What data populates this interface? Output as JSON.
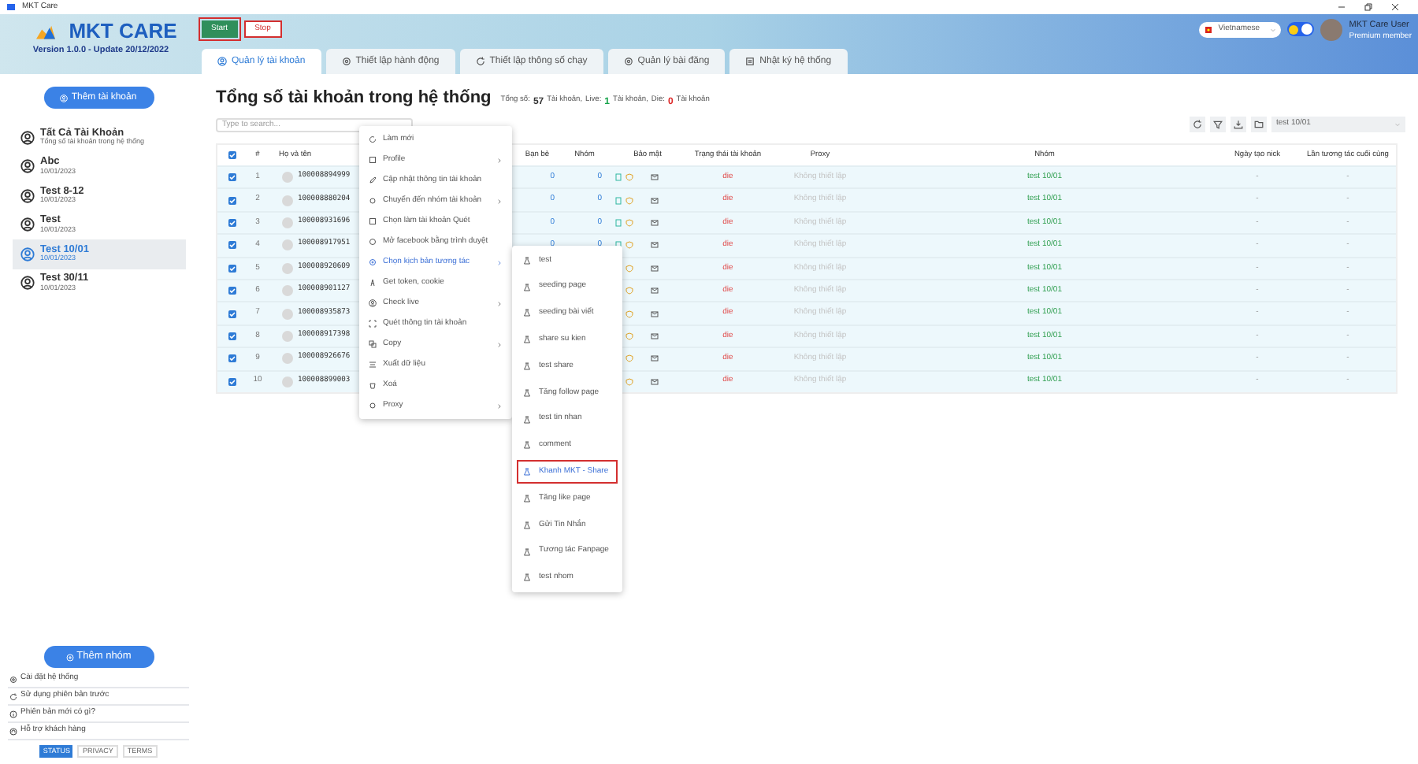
{
  "app_title": "MKT Care",
  "logo": {
    "name": "MKT CARE",
    "version": "Version 1.0.0 - Update 20/12/2022"
  },
  "run_buttons": [
    {
      "kind": "start",
      "label": "Start"
    },
    {
      "kind": "stop",
      "label": "Stop"
    }
  ],
  "tabs": [
    {
      "label": "Quản lý tài khoản",
      "selected": true
    },
    {
      "label": "Thiết lập hành động",
      "selected": false
    },
    {
      "label": "Thiết lập thông số chạy",
      "selected": false
    },
    {
      "label": "Quản lý bài đăng",
      "selected": false
    },
    {
      "label": "Nhật ký hệ thống",
      "selected": false
    }
  ],
  "language": "Vietnamese",
  "theme_toggle": {
    "on": true
  },
  "user": {
    "name": "MKT Care User",
    "badge": "Premium member"
  },
  "sidebar": {
    "add_button": "Thêm tài khoản",
    "items": [
      {
        "title": "Tất Cả Tài Khoản",
        "subtitle": "Tổng số tài khoản trong hệ thống",
        "selected": false
      },
      {
        "title": "Abc",
        "subtitle": "10/01/2023",
        "selected": false
      },
      {
        "title": "Test 8-12",
        "subtitle": "10/01/2023",
        "selected": false
      },
      {
        "title": "Test",
        "subtitle": "10/01/2023",
        "selected": false
      },
      {
        "title": "Test 10/01",
        "subtitle": "10/01/2023",
        "selected": true
      },
      {
        "title": "Test 30/11",
        "subtitle": "10/01/2023",
        "selected": false
      }
    ],
    "add_group_button": "Thêm nhóm",
    "links": [
      "Cài đặt hệ thống",
      "Sử dụng phiên bản trước",
      "Phiên bản mới có gì?",
      "Hỗ trợ khách hàng"
    ],
    "footer_tabs": [
      {
        "label": "STATUS",
        "selected": true
      },
      {
        "label": "PRIVACY",
        "selected": false
      },
      {
        "label": "TERMS",
        "selected": false
      }
    ]
  },
  "main": {
    "title": "Tổng số tài khoản trong hệ thống",
    "stats": [
      {
        "label": "Tổng số:",
        "value": "57",
        "unit": "Tài khoản,",
        "color": "#333333"
      },
      {
        "label": "Live:",
        "value": "1",
        "unit": "Tài khoản,",
        "color": "#16a34a"
      },
      {
        "label": "Die:",
        "value": "0",
        "unit": "Tài khoản",
        "color": "#dc2626"
      }
    ],
    "search": {
      "placeholder": "Type to search..."
    },
    "group_select": "test 10/01"
  },
  "table": {
    "select_all_checked": true,
    "columns": [
      "#",
      "Họ và tên",
      "Bạn bè",
      "Nhóm",
      "Bảo mật",
      "Trạng thái tài khoản",
      "Proxy",
      "Nhóm",
      "Ngày tạo nick",
      "Lần tương tác cuối cùng"
    ],
    "rows": [
      {
        "checked": true,
        "index": "1",
        "name": "100008894999",
        "friends": "0",
        "groups": "0",
        "status": "die",
        "proxy": "Không thiết lập",
        "group": "test 10/01",
        "created": "-",
        "last": "-"
      },
      {
        "checked": true,
        "index": "2",
        "name": "100008880204",
        "friends": "0",
        "groups": "0",
        "status": "die",
        "proxy": "Không thiết lập",
        "group": "test 10/01",
        "created": "-",
        "last": "-"
      },
      {
        "checked": true,
        "index": "3",
        "name": "100008931696",
        "friends": "0",
        "groups": "0",
        "status": "die",
        "proxy": "Không thiết lập",
        "group": "test 10/01",
        "created": "-",
        "last": "-"
      },
      {
        "checked": true,
        "index": "4",
        "name": "100008917951",
        "friends": "0",
        "groups": "0",
        "status": "die",
        "proxy": "Không thiết lập",
        "group": "test 10/01",
        "created": "-",
        "last": "-"
      },
      {
        "checked": true,
        "index": "5",
        "name": "100008920609",
        "status": "die",
        "proxy": "Không thiết lập",
        "group": "test 10/01",
        "created": "-",
        "last": "-"
      },
      {
        "checked": true,
        "index": "6",
        "name": "100008901127",
        "status": "die",
        "proxy": "Không thiết lập",
        "group": "test 10/01",
        "created": "-",
        "last": "-"
      },
      {
        "checked": true,
        "index": "7",
        "name": "100008935873",
        "status": "die",
        "proxy": "Không thiết lập",
        "group": "test 10/01",
        "created": "-",
        "last": "-"
      },
      {
        "checked": true,
        "index": "8",
        "name": "100008917398",
        "status": "die",
        "proxy": "Không thiết lập",
        "group": "test 10/01",
        "created": "-",
        "last": "-"
      },
      {
        "checked": true,
        "index": "9",
        "name": "100008926676",
        "status": "die",
        "proxy": "Không thiết lập",
        "group": "test 10/01",
        "created": "-",
        "last": "-"
      },
      {
        "checked": true,
        "index": "10",
        "name": "100008899003",
        "status": "die",
        "proxy": "Không thiết lập",
        "group": "test 10/01",
        "created": "-",
        "last": "-"
      }
    ]
  },
  "context_menu": [
    {
      "label": "Làm mới",
      "submenu": false,
      "selected": false
    },
    {
      "label": "Profile",
      "submenu": true,
      "selected": false
    },
    {
      "label": "Cập nhật thông tin tài khoản",
      "submenu": false,
      "selected": false
    },
    {
      "label": "Chuyển đến nhóm tài khoản",
      "submenu": true,
      "selected": false
    },
    {
      "label": "Chọn làm tài khoản Quét",
      "submenu": false,
      "selected": false
    },
    {
      "label": "Mở facebook bằng trình duyệt",
      "submenu": false,
      "selected": false
    },
    {
      "label": "Chọn kịch bản tương tác",
      "submenu": true,
      "selected": true
    },
    {
      "label": "Get token, cookie",
      "submenu": false,
      "selected": false
    },
    {
      "label": "Check live",
      "submenu": true,
      "selected": false
    },
    {
      "label": "Quét thông tin tài khoản",
      "submenu": false,
      "selected": false
    },
    {
      "label": "Copy",
      "submenu": true,
      "selected": false
    },
    {
      "label": "Xuất dữ liệu",
      "submenu": false,
      "selected": false
    },
    {
      "label": "Xoá",
      "submenu": false,
      "selected": false
    },
    {
      "label": "Proxy",
      "submenu": true,
      "selected": false
    }
  ],
  "submenu": [
    {
      "label": "test",
      "selected": false
    },
    {
      "label": "seeding page",
      "selected": false
    },
    {
      "label": "seeding bài viết",
      "selected": false
    },
    {
      "label": "share su kien",
      "selected": false
    },
    {
      "label": "test share",
      "selected": false
    },
    {
      "label": "Tăng follow page",
      "selected": false
    },
    {
      "label": "test tin nhan",
      "selected": false
    },
    {
      "label": "comment",
      "selected": false
    },
    {
      "label": "Khanh MKT - Share",
      "selected": true
    },
    {
      "label": "Tăng like page",
      "selected": false
    },
    {
      "label": "Gửi Tin Nhắn",
      "selected": false
    },
    {
      "label": "Tương tác Fanpage",
      "selected": false
    },
    {
      "label": "test nhom",
      "selected": false
    }
  ]
}
